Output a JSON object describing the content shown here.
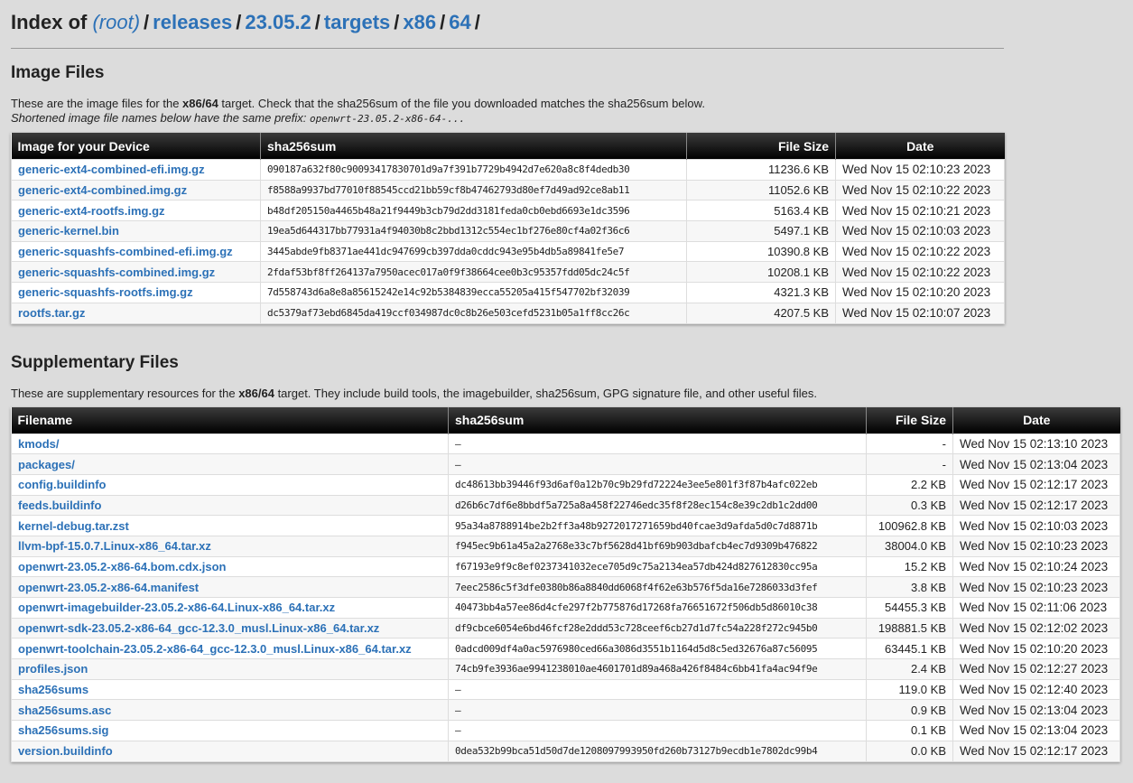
{
  "breadcrumb": {
    "prefix": "Index of",
    "items": [
      "(root)",
      "releases",
      "23.05.2",
      "targets",
      "x86",
      "64"
    ],
    "sep": "/"
  },
  "image_section": {
    "title": "Image Files",
    "desc_pre": "These are the image files for the ",
    "desc_target": "x86/64",
    "desc_post": " target. Check that the sha256sum of the file you downloaded matches the sha256sum below.",
    "desc_line2": "Shortened image file names below have the same prefix: ",
    "prefix_code": "openwrt-23.05.2-x86-64-...",
    "headers": [
      "Image for your Device",
      "sha256sum",
      "File Size",
      "Date"
    ],
    "rows": [
      {
        "name": "generic-ext4-combined-efi.img.gz",
        "hash": "090187a632f80c90093417830701d9a7f391b7729b4942d7e620a8c8f4dedb30",
        "size": "11236.6 KB",
        "date": "Wed Nov 15 02:10:23 2023"
      },
      {
        "name": "generic-ext4-combined.img.gz",
        "hash": "f8588a9937bd77010f88545ccd21bb59cf8b47462793d80ef7d49ad92ce8ab11",
        "size": "11052.6 KB",
        "date": "Wed Nov 15 02:10:22 2023"
      },
      {
        "name": "generic-ext4-rootfs.img.gz",
        "hash": "b48df205150a4465b48a21f9449b3cb79d2dd3181feda0cb0ebd6693e1dc3596",
        "size": "5163.4 KB",
        "date": "Wed Nov 15 02:10:21 2023"
      },
      {
        "name": "generic-kernel.bin",
        "hash": "19ea5d644317bb77931a4f94030b8c2bbd1312c554ec1bf276e80cf4a02f36c6",
        "size": "5497.1 KB",
        "date": "Wed Nov 15 02:10:03 2023"
      },
      {
        "name": "generic-squashfs-combined-efi.img.gz",
        "hash": "3445abde9fb8371ae441dc947699cb397dda0cddc943e95b4db5a89841fe5e7",
        "size": "10390.8 KB",
        "date": "Wed Nov 15 02:10:22 2023"
      },
      {
        "name": "generic-squashfs-combined.img.gz",
        "hash": "2fdaf53bf8ff264137a7950acec017a0f9f38664cee0b3c95357fdd05dc24c5f",
        "size": "10208.1 KB",
        "date": "Wed Nov 15 02:10:22 2023"
      },
      {
        "name": "generic-squashfs-rootfs.img.gz",
        "hash": "7d558743d6a8e8a85615242e14c92b5384839ecca55205a415f547702bf32039",
        "size": "4321.3 KB",
        "date": "Wed Nov 15 02:10:20 2023"
      },
      {
        "name": "rootfs.tar.gz",
        "hash": "dc5379af73ebd6845da419ccf034987dc0c8b26e503cefd5231b05a1ff8cc26c",
        "size": "4207.5 KB",
        "date": "Wed Nov 15 02:10:07 2023"
      }
    ]
  },
  "supp_section": {
    "title": "Supplementary Files",
    "desc_pre": "These are supplementary resources for the ",
    "desc_target": "x86/64",
    "desc_post": " target. They include build tools, the imagebuilder, sha256sum, GPG signature file, and other useful files.",
    "headers": [
      "Filename",
      "sha256sum",
      "File Size",
      "Date"
    ],
    "rows": [
      {
        "name": "kmods/",
        "hash": "–",
        "size": "-",
        "date": "Wed Nov 15 02:13:10 2023"
      },
      {
        "name": "packages/",
        "hash": "–",
        "size": "-",
        "date": "Wed Nov 15 02:13:04 2023"
      },
      {
        "name": "config.buildinfo",
        "hash": "dc48613bb39446f93d6af0a12b70c9b29fd72224e3ee5e801f3f87b4afc022eb",
        "size": "2.2 KB",
        "date": "Wed Nov 15 02:12:17 2023"
      },
      {
        "name": "feeds.buildinfo",
        "hash": "d26b6c7df6e8bbdf5a725a8a458f22746edc35f8f28ec154c8e39c2db1c2dd00",
        "size": "0.3 KB",
        "date": "Wed Nov 15 02:12:17 2023"
      },
      {
        "name": "kernel-debug.tar.zst",
        "hash": "95a34a8788914be2b2ff3a48b9272017271659bd40fcae3d9afda5d0c7d8871b",
        "size": "100962.8 KB",
        "date": "Wed Nov 15 02:10:03 2023"
      },
      {
        "name": "llvm-bpf-15.0.7.Linux-x86_64.tar.xz",
        "hash": "f945ec9b61a45a2a2768e33c7bf5628d41bf69b903dbafcb4ec7d9309b476822",
        "size": "38004.0 KB",
        "date": "Wed Nov 15 02:10:23 2023"
      },
      {
        "name": "openwrt-23.05.2-x86-64.bom.cdx.json",
        "hash": "f67193e9f9c8ef0237341032ece705d9c75a2134ea57db424d827612830cc95a",
        "size": "15.2 KB",
        "date": "Wed Nov 15 02:10:24 2023"
      },
      {
        "name": "openwrt-23.05.2-x86-64.manifest",
        "hash": "7eec2586c5f3dfe0380b86a8840dd6068f4f62e63b576f5da16e7286033d3fef",
        "size": "3.8 KB",
        "date": "Wed Nov 15 02:10:23 2023"
      },
      {
        "name": "openwrt-imagebuilder-23.05.2-x86-64.Linux-x86_64.tar.xz",
        "hash": "40473bb4a57ee86d4cfe297f2b775876d17268fa76651672f506db5d86010c38",
        "size": "54455.3 KB",
        "date": "Wed Nov 15 02:11:06 2023"
      },
      {
        "name": "openwrt-sdk-23.05.2-x86-64_gcc-12.3.0_musl.Linux-x86_64.tar.xz",
        "hash": "df9cbce6054e6bd46fcf28e2ddd53c728ceef6cb27d1d7fc54a228f272c945b0",
        "size": "198881.5 KB",
        "date": "Wed Nov 15 02:12:02 2023"
      },
      {
        "name": "openwrt-toolchain-23.05.2-x86-64_gcc-12.3.0_musl.Linux-x86_64.tar.xz",
        "hash": "0adcd009df4a0ac5976980ced66a3086d3551b1164d5d8c5ed32676a87c56095",
        "size": "63445.1 KB",
        "date": "Wed Nov 15 02:10:20 2023"
      },
      {
        "name": "profiles.json",
        "hash": "74cb9fe3936ae9941238010ae4601701d89a468a426f8484c6bb41fa4ac94f9e",
        "size": "2.4 KB",
        "date": "Wed Nov 15 02:12:27 2023"
      },
      {
        "name": "sha256sums",
        "hash": "–",
        "size": "119.0 KB",
        "date": "Wed Nov 15 02:12:40 2023"
      },
      {
        "name": "sha256sums.asc",
        "hash": "–",
        "size": "0.9 KB",
        "date": "Wed Nov 15 02:13:04 2023"
      },
      {
        "name": "sha256sums.sig",
        "hash": "–",
        "size": "0.1 KB",
        "date": "Wed Nov 15 02:13:04 2023"
      },
      {
        "name": "version.buildinfo",
        "hash": "0dea532b99bca51d50d7de1208097993950fd260b73127b9ecdb1e7802dc99b4",
        "size": "0.0 KB",
        "date": "Wed Nov 15 02:12:17 2023"
      }
    ]
  },
  "colors": {
    "link": "#2c71b7",
    "background": "#dcdcdc",
    "header_bg": "#000000"
  }
}
